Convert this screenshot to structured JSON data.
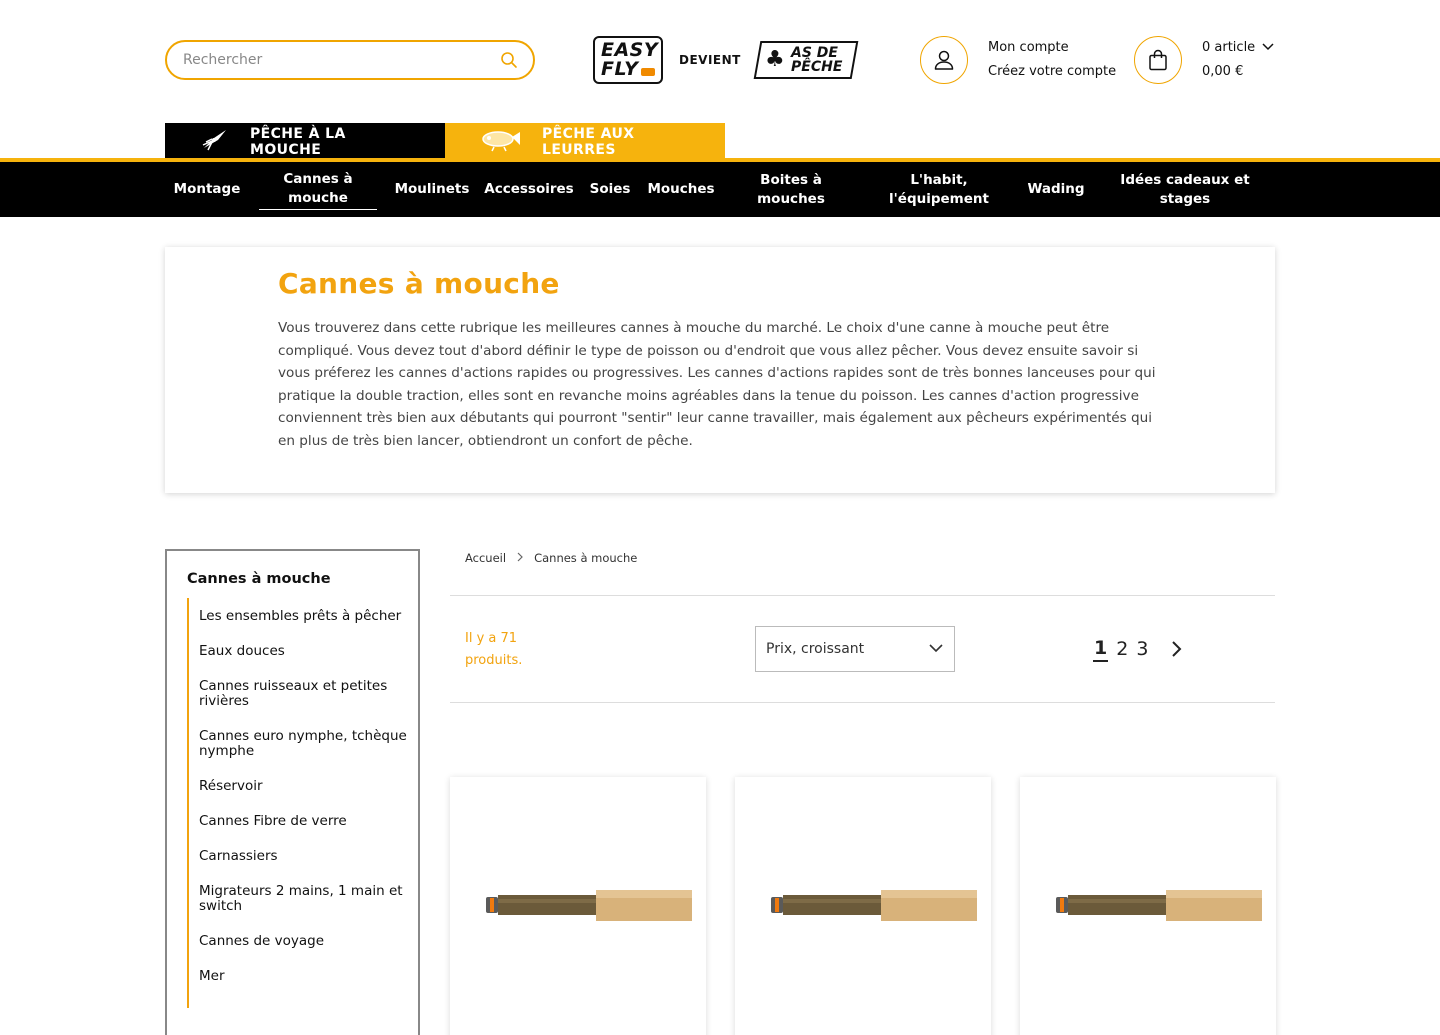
{
  "header": {
    "search_placeholder": "Rechercher",
    "logo_left": "EASY FLY",
    "logo_mid": "DEVIENT",
    "logo_right": "AS DE PÊCHE",
    "account": {
      "title": "Mon compte",
      "subtitle": "Créez votre compte"
    },
    "cart": {
      "count": "0 article",
      "total": "0,00 €"
    }
  },
  "tabs": [
    {
      "label": "PÊCHE À LA MOUCHE"
    },
    {
      "label": "PÊCHE AUX LEURRES"
    }
  ],
  "nav": {
    "items": [
      {
        "label": "Montage"
      },
      {
        "label": "Cannes à mouche"
      },
      {
        "label": "Moulinets"
      },
      {
        "label": "Accessoires"
      },
      {
        "label": "Soies"
      },
      {
        "label": "Mouches"
      },
      {
        "label": "Boites à mouches"
      },
      {
        "label": "L'habit, l'équipement"
      },
      {
        "label": "Wading"
      },
      {
        "label": "Idées cadeaux et stages"
      }
    ]
  },
  "category": {
    "title": "Cannes à mouche",
    "description": "Vous trouverez dans cette rubrique les meilleures cannes à mouche du marché. Le choix d'une canne à mouche peut être compliqué. Vous devez tout d'abord définir le type de poisson ou d'endroit que vous allez pêcher. Vous devez ensuite savoir si vous préferez les cannes d'actions rapides ou progressives. Les cannes d'actions rapides sont de très bonnes lanceuses pour qui pratique la double traction, elles sont en revanche moins agréables dans la tenue du poisson. Les cannes d'action progressive conviennent très bien aux débutants qui pourront \"sentir\" leur canne travailler, mais également aux pêcheurs expérimentés qui en plus de très bien lancer, obtiendront un confort de pêche."
  },
  "sidebar": {
    "title": "Cannes à mouche",
    "items": [
      {
        "label": "Les ensembles prêts à pêcher"
      },
      {
        "label": "Eaux douces"
      },
      {
        "label": "Cannes ruisseaux et petites rivières"
      },
      {
        "label": "Cannes euro nymphe, tchèque nymphe"
      },
      {
        "label": "Réservoir"
      },
      {
        "label": "Cannes Fibre de verre"
      },
      {
        "label": "Carnassiers"
      },
      {
        "label": "Migrateurs 2 mains, 1 main et switch"
      },
      {
        "label": "Cannes de voyage"
      },
      {
        "label": "Mer"
      }
    ]
  },
  "breadcrumb": {
    "home": "Accueil",
    "current": "Cannes à mouche"
  },
  "listing": {
    "count_text": "Il y a 71 produits.",
    "sort_selected": "Prix, croissant",
    "pages": [
      "1",
      "2",
      "3"
    ],
    "current_page": "1"
  },
  "colors": {
    "accent": "#f6b30d",
    "title": "#f2a30f",
    "nav_bg": "#000000"
  },
  "icons": [
    "search-icon",
    "user-icon",
    "shopping-bag-icon",
    "chevron-down-icon",
    "chevron-right-icon",
    "fly-icon",
    "lure-icon"
  ]
}
